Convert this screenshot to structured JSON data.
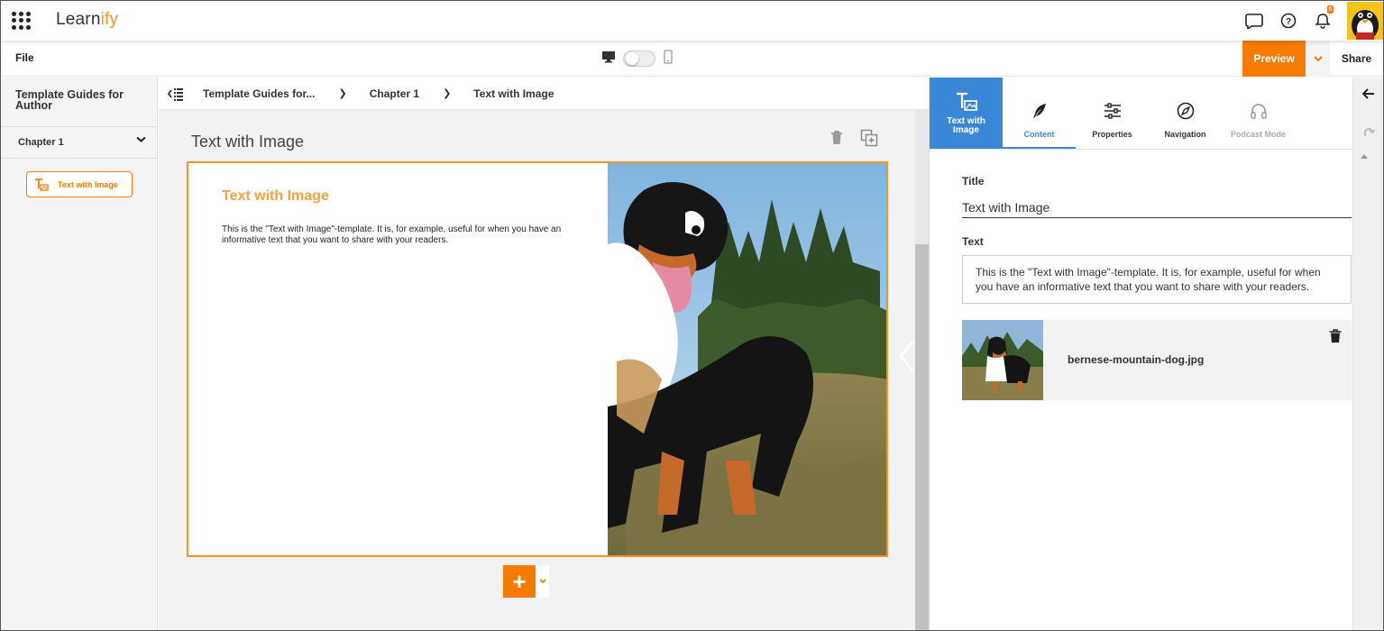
{
  "app": {
    "logo_text": "Learn",
    "logo_accent": "ify",
    "notification_count": "6",
    "accent_color": "#f57c00",
    "panel_color": "#3a87d8"
  },
  "toolbar": {
    "file_label": "File",
    "preview_label": "Preview",
    "share_label": "Share"
  },
  "sidebar": {
    "course_title": "Template Guides for Author",
    "chapter_label": "Chapter 1",
    "page_label": "Text with Image"
  },
  "breadcrumb": {
    "items": [
      "Template Guides for...",
      "Chapter 1",
      "Text with Image"
    ]
  },
  "canvas": {
    "page_title": "Text with Image",
    "heading": "Text with Image",
    "body": "This is the \"Text with Image\"-template. It is, for example, useful for when you have an informative text that you want to share with your readers."
  },
  "panel": {
    "type_label": "Text with Image",
    "tabs": [
      {
        "label": "Content",
        "icon": "feather-icon",
        "state": "active"
      },
      {
        "label": "Properties",
        "icon": "sliders-icon",
        "state": "normal"
      },
      {
        "label": "Navigation",
        "icon": "compass-icon",
        "state": "normal"
      },
      {
        "label": "Podcast Mode",
        "icon": "headphones-icon",
        "state": "disabled"
      }
    ],
    "title_label": "Title",
    "title_value": "Text with Image",
    "text_label": "Text",
    "text_value": "This is the \"Text with Image\"-template. It is, for example, useful for when you have an informative text that you want to share with your readers.",
    "image_filename": "bernese-mountain-dog.jpg"
  }
}
